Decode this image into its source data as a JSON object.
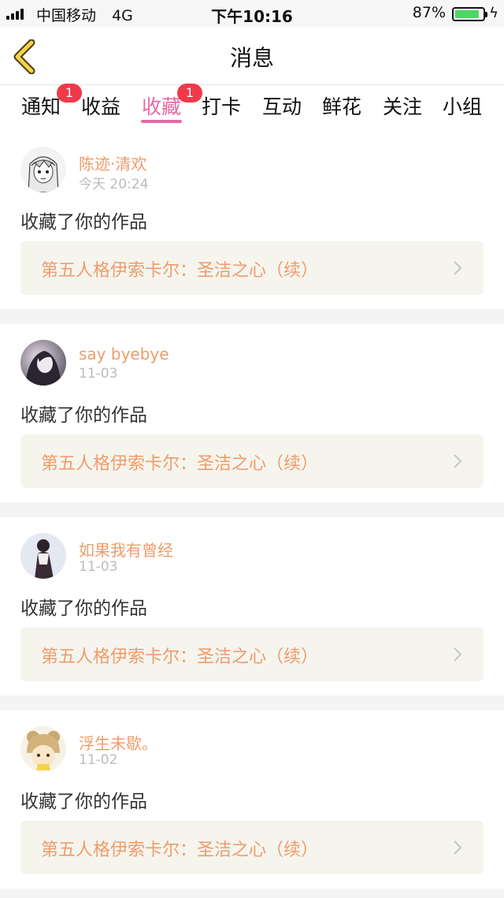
{
  "status_bar": {
    "carrier": "中国移动",
    "network": "4G",
    "time": "下午10:16",
    "battery": "87%",
    "battery_level": 0.87
  },
  "nav": {
    "title": "消息",
    "back_icon": "chevron-left-icon"
  },
  "tabs": [
    {
      "label": "通知",
      "badge": "1",
      "active": false
    },
    {
      "label": "收益",
      "badge": "",
      "active": false
    },
    {
      "label": "收藏",
      "badge": "1",
      "active": true
    },
    {
      "label": "打卡",
      "badge": "",
      "active": false
    },
    {
      "label": "互动",
      "badge": "",
      "active": false
    },
    {
      "label": "鲜花",
      "badge": "",
      "active": false
    },
    {
      "label": "关注",
      "badge": "",
      "active": false
    },
    {
      "label": "小组",
      "badge": "",
      "active": false
    }
  ],
  "items": [
    {
      "user": "陈迹·清欢",
      "time": "今天 20:24",
      "action": "收藏了你的作品",
      "work": "第五人格伊索卡尔：圣洁之心（续）"
    },
    {
      "user": "say byebye",
      "time": "11-03",
      "action": "收藏了你的作品",
      "work": "第五人格伊索卡尔：圣洁之心（续）"
    },
    {
      "user": "如果我有曾经",
      "time": "11-03",
      "action": "收藏了你的作品",
      "work": "第五人格伊索卡尔：圣洁之心（续）"
    },
    {
      "user": "浮生未歇。",
      "time": "11-02",
      "action": "收藏了你的作品",
      "work": "第五人格伊索卡尔：圣洁之心（续）"
    }
  ],
  "colors": {
    "accent": "#e26aa4",
    "badge": "#f0394a",
    "username": "#ef9c6a",
    "work_title": "#f09c6c",
    "battery": "#4cd964"
  }
}
